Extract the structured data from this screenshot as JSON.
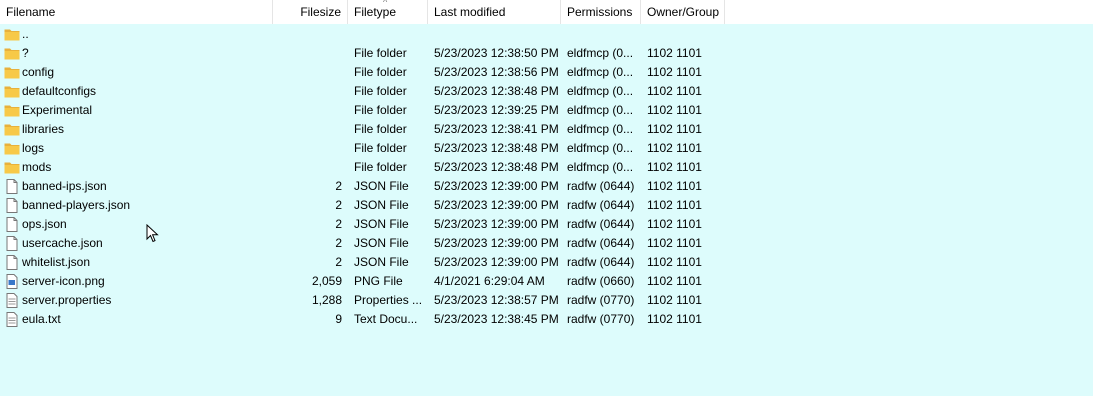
{
  "columns": {
    "filename": "Filename",
    "filesize": "Filesize",
    "filetype": "Filetype",
    "last_modified": "Last modified",
    "permissions": "Permissions",
    "owner_group": "Owner/Group"
  },
  "sort_indicator": "^",
  "rows": [
    {
      "name": "..",
      "size": "",
      "type": "",
      "modified": "",
      "perms": "",
      "owner": "",
      "icon": "folder-icon"
    },
    {
      "name": "?",
      "size": "",
      "type": "File folder",
      "modified": "5/23/2023 12:38:50 PM",
      "perms": "eldfmcp (0...",
      "owner": "1102 1101",
      "icon": "folder-icon"
    },
    {
      "name": "config",
      "size": "",
      "type": "File folder",
      "modified": "5/23/2023 12:38:56 PM",
      "perms": "eldfmcp (0...",
      "owner": "1102 1101",
      "icon": "folder-icon"
    },
    {
      "name": "defaultconfigs",
      "size": "",
      "type": "File folder",
      "modified": "5/23/2023 12:38:48 PM",
      "perms": "eldfmcp (0...",
      "owner": "1102 1101",
      "icon": "folder-icon"
    },
    {
      "name": "Experimental",
      "size": "",
      "type": "File folder",
      "modified": "5/23/2023 12:39:25 PM",
      "perms": "eldfmcp (0...",
      "owner": "1102 1101",
      "icon": "folder-icon"
    },
    {
      "name": "libraries",
      "size": "",
      "type": "File folder",
      "modified": "5/23/2023 12:38:41 PM",
      "perms": "eldfmcp (0...",
      "owner": "1102 1101",
      "icon": "folder-icon"
    },
    {
      "name": "logs",
      "size": "",
      "type": "File folder",
      "modified": "5/23/2023 12:38:48 PM",
      "perms": "eldfmcp (0...",
      "owner": "1102 1101",
      "icon": "folder-icon"
    },
    {
      "name": "mods",
      "size": "",
      "type": "File folder",
      "modified": "5/23/2023 12:38:48 PM",
      "perms": "eldfmcp (0...",
      "owner": "1102 1101",
      "icon": "folder-icon"
    },
    {
      "name": "banned-ips.json",
      "size": "2",
      "type": "JSON File",
      "modified": "5/23/2023 12:39:00 PM",
      "perms": "radfw (0644)",
      "owner": "1102 1101",
      "icon": "file-icon"
    },
    {
      "name": "banned-players.json",
      "size": "2",
      "type": "JSON File",
      "modified": "5/23/2023 12:39:00 PM",
      "perms": "radfw (0644)",
      "owner": "1102 1101",
      "icon": "file-icon"
    },
    {
      "name": "ops.json",
      "size": "2",
      "type": "JSON File",
      "modified": "5/23/2023 12:39:00 PM",
      "perms": "radfw (0644)",
      "owner": "1102 1101",
      "icon": "file-icon"
    },
    {
      "name": "usercache.json",
      "size": "2",
      "type": "JSON File",
      "modified": "5/23/2023 12:39:00 PM",
      "perms": "radfw (0644)",
      "owner": "1102 1101",
      "icon": "file-icon"
    },
    {
      "name": "whitelist.json",
      "size": "2",
      "type": "JSON File",
      "modified": "5/23/2023 12:39:00 PM",
      "perms": "radfw (0644)",
      "owner": "1102 1101",
      "icon": "file-icon"
    },
    {
      "name": "server-icon.png",
      "size": "2,059",
      "type": "PNG File",
      "modified": "4/1/2021 6:29:04 AM",
      "perms": "radfw (0660)",
      "owner": "1102 1101",
      "icon": "image-file-icon"
    },
    {
      "name": "server.properties",
      "size": "1,288",
      "type": "Properties ...",
      "modified": "5/23/2023 12:38:57 PM",
      "perms": "radfw (0770)",
      "owner": "1102 1101",
      "icon": "properties-file-icon"
    },
    {
      "name": "eula.txt",
      "size": "9",
      "type": "Text Docu...",
      "modified": "5/23/2023 12:38:45 PM",
      "perms": "radfw (0770)",
      "owner": "1102 1101",
      "icon": "text-file-icon"
    }
  ],
  "colors": {
    "list_background": "#ddfcfc",
    "header_background": "#ffffff",
    "folder_yellow": "#f7c948"
  }
}
